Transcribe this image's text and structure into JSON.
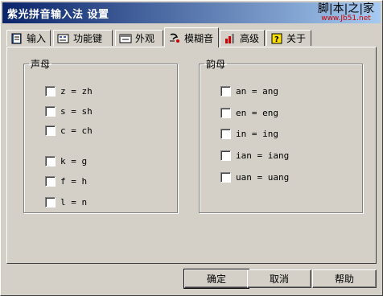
{
  "window": {
    "title": "紫光拼音输入法 设置"
  },
  "watermark": {
    "chars": [
      "脚",
      "本",
      "之",
      "家"
    ],
    "url": "www.Jb51.net"
  },
  "tabs": [
    {
      "label": "输入",
      "icon": "book-icon",
      "active": false
    },
    {
      "label": "功能键",
      "icon": "keyboard-icon",
      "active": false
    },
    {
      "label": "外观",
      "icon": "window-icon",
      "active": false
    },
    {
      "label": "模糊音",
      "icon": "sound-icon",
      "active": true
    },
    {
      "label": "高级",
      "icon": "chart-icon",
      "active": false
    },
    {
      "label": "关于",
      "icon": "question-icon",
      "active": false
    }
  ],
  "initials": {
    "legend": "声母",
    "items": [
      {
        "label": "z = zh",
        "checked": false
      },
      {
        "label": "s = sh",
        "checked": false
      },
      {
        "label": "c = ch",
        "checked": false
      },
      {
        "label": "k = g",
        "checked": false
      },
      {
        "label": "f = h",
        "checked": false
      },
      {
        "label": "l = n",
        "checked": false
      }
    ]
  },
  "finals": {
    "legend": "韵母",
    "items": [
      {
        "label": "an = ang",
        "checked": false
      },
      {
        "label": "en = eng",
        "checked": false
      },
      {
        "label": "in = ing",
        "checked": false
      },
      {
        "label": "ian = iang",
        "checked": false
      },
      {
        "label": "uan = uang",
        "checked": false
      }
    ]
  },
  "buttons": {
    "ok": "确定",
    "cancel": "取消",
    "help": "帮助"
  },
  "colors": {
    "face": "#d4d0c8",
    "title_start": "#0a246a",
    "title_end": "#a6caf0"
  }
}
